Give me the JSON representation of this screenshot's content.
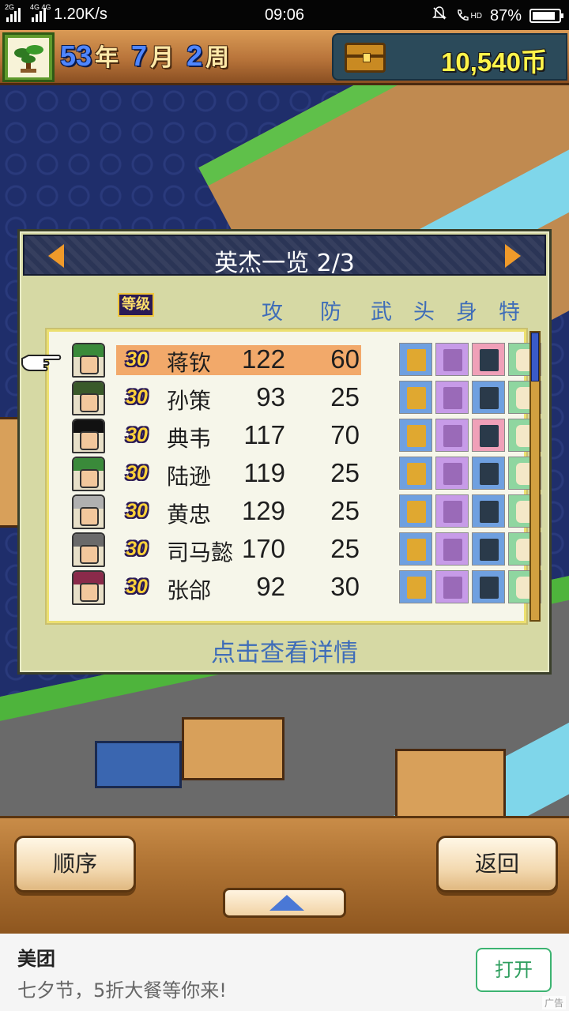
{
  "status_bar": {
    "net1": "2G",
    "net2": "4G 4G",
    "speed": "1.20K/s",
    "time": "09:06",
    "hd": "HD",
    "battery": "87%",
    "battery_level": 0.87
  },
  "topbar": {
    "year_num": "53",
    "year_unit": "年",
    "month_num": "7",
    "month_unit": "月",
    "week_num": "2",
    "week_unit": "周",
    "money": "10,540币"
  },
  "panel": {
    "title": "英杰一览 2/3",
    "level_header": "等级",
    "col_atk": "攻",
    "col_def": "防",
    "col_weapon": "武",
    "col_head": "头",
    "col_body": "身",
    "col_special": "特",
    "detail_link": "点击查看详情",
    "scroll_position": 0.0
  },
  "heroes": [
    {
      "level": "30",
      "name": "蒋钦",
      "atk": "122",
      "def": "60",
      "selected": true,
      "hat_color": "#3a8a3a",
      "equip": [
        "#6fa0e0",
        "#c79be8",
        "#f0a0b8",
        "#8fd6a0"
      ]
    },
    {
      "level": "30",
      "name": "孙策",
      "atk": "93",
      "def": "25",
      "selected": false,
      "hat_color": "#3a5a2a",
      "equip": [
        "#6fa0e0",
        "#c79be8",
        "#6fa0e0",
        "#8fd6a0"
      ]
    },
    {
      "level": "30",
      "name": "典韦",
      "atk": "117",
      "def": "70",
      "selected": false,
      "hat_color": "#111111",
      "equip": [
        "#6fa0e0",
        "#c79be8",
        "#f0a0b8",
        "#8fd6a0"
      ]
    },
    {
      "level": "30",
      "name": "陆逊",
      "atk": "119",
      "def": "25",
      "selected": false,
      "hat_color": "#3a8a3a",
      "equip": [
        "#6fa0e0",
        "#c79be8",
        "#6fa0e0",
        "#8fd6a0"
      ]
    },
    {
      "level": "30",
      "name": "黄忠",
      "atk": "129",
      "def": "25",
      "selected": false,
      "hat_color": "#b0b0b0",
      "equip": [
        "#6fa0e0",
        "#c79be8",
        "#6fa0e0",
        "#8fd6a0"
      ]
    },
    {
      "level": "30",
      "name": "司马懿",
      "atk": "170",
      "def": "25",
      "selected": false,
      "hat_color": "#6a6a6a",
      "equip": [
        "#6fa0e0",
        "#c79be8",
        "#6fa0e0",
        "#8fd6a0"
      ]
    },
    {
      "level": "30",
      "name": "张郃",
      "atk": "92",
      "def": "30",
      "selected": false,
      "hat_color": "#8a2a4a",
      "equip": [
        "#6fa0e0",
        "#c79be8",
        "#6fa0e0",
        "#8fd6a0"
      ]
    }
  ],
  "bottom": {
    "order_label": "顺序",
    "back_label": "返回"
  },
  "ad": {
    "brand": "美团",
    "text": "七夕节，5折大餐等你来!",
    "open_label": "打开",
    "tag": "广告"
  }
}
